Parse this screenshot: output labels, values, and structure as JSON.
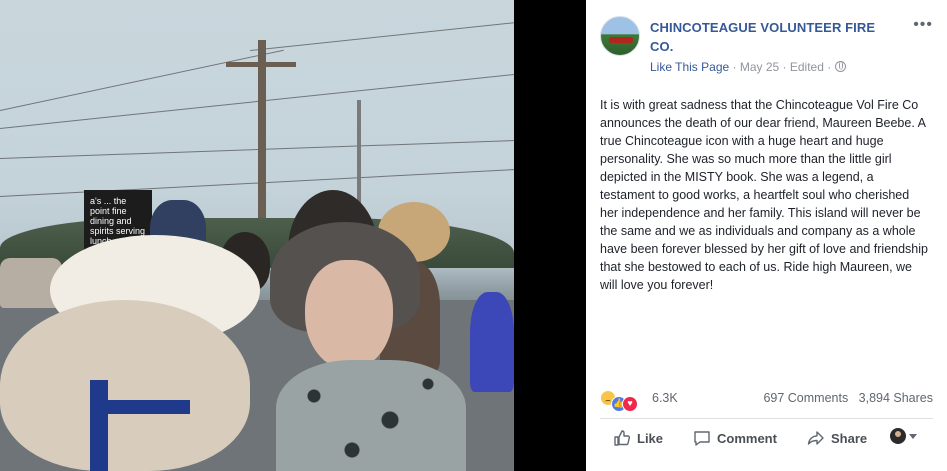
{
  "photo": {
    "sign_text": "a's ... the point fine dining and spirits serving lunch"
  },
  "post": {
    "page_name": "CHINCOTEAGUE VOLUNTEER FIRE CO.",
    "like_page": "Like This Page",
    "sep1": " · ",
    "date": "May 25",
    "sep2": " · ",
    "edited": "Edited",
    "sep3": " · ",
    "more_label": "•••",
    "text": "It is with great sadness that the Chincoteague Vol Fire Co announces the death of our dear friend, Maureen Beebe. A true Chincoteague icon with a huge heart and huge personality. She was so much more than the little girl depicted in the MISTY book. She was a legend, a testament to good works, a heartfelt soul who cherished her independence and her family. This island will never be the same and we as individuals and company as a whole have been forever blessed by her gift of love and friendship that she bestowed to each of us. Ride high Maureen, we will love you forever!"
  },
  "stats": {
    "reaction_icons": [
      "sad-icon",
      "like-icon",
      "love-icon"
    ],
    "reactions_count": "6.3K",
    "comments": "697 Comments",
    "shares": "3,894 Shares"
  },
  "actions": {
    "like": "Like",
    "comment": "Comment",
    "share": "Share"
  },
  "colors": {
    "link": "#365899",
    "meta": "#90949c",
    "text": "#1d2129"
  }
}
